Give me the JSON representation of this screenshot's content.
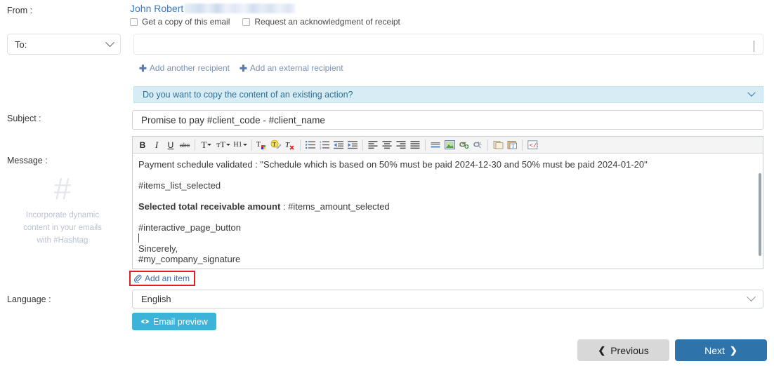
{
  "labels": {
    "from": "From :",
    "subject": "Subject :",
    "message": "Message :",
    "language": "Language :"
  },
  "from": {
    "sender_name": "John Robert",
    "sender_email_redacted": "",
    "copy_checkbox_label": "Get a copy of this email",
    "copy_checked": false,
    "receipt_checkbox_label": "Request an acknowledgment of receipt",
    "receipt_checked": false
  },
  "recipients": {
    "type_select_value": "To:",
    "recipient_value": "",
    "add_another_label": "Add another recipient",
    "add_external_label": "Add an external recipient"
  },
  "copy_action_banner": {
    "text": "Do you want to copy the content of an existing action?"
  },
  "subject": {
    "value": "Promise to pay #client_code - #client_name"
  },
  "message_hint": {
    "glyph": "#",
    "line1": "Incorporate dynamic",
    "line2": "content in your emails",
    "line3": "with #Hashtag"
  },
  "editor": {
    "toolbar": [
      {
        "name": "bold-icon",
        "glyph": "B",
        "style": "bold"
      },
      {
        "name": "italic-icon",
        "glyph": "I",
        "style": "italic"
      },
      {
        "name": "underline-icon",
        "glyph": "U",
        "style": "underline"
      },
      {
        "name": "strikethrough-icon",
        "glyph": "abc",
        "style": "strike"
      },
      {
        "name": "font-family-icon",
        "glyph": "T",
        "style": "dropdown"
      },
      {
        "name": "font-size-icon",
        "glyph": "tT",
        "style": "dropdown"
      },
      {
        "name": "heading-icon",
        "glyph": "H1",
        "style": "dropdown"
      },
      {
        "name": "text-color-icon",
        "glyph": "T",
        "style": "color"
      },
      {
        "name": "background-color-icon",
        "glyph": "T",
        "style": "highlight"
      },
      {
        "name": "remove-format-icon",
        "glyph": "T",
        "style": "removefmt"
      },
      {
        "name": "bulleted-list-icon",
        "glyph": "",
        "style": "ullist"
      },
      {
        "name": "numbered-list-icon",
        "glyph": "",
        "style": "ollist"
      },
      {
        "name": "decrease-indent-icon",
        "glyph": "",
        "style": "outdent"
      },
      {
        "name": "increase-indent-icon",
        "glyph": "",
        "style": "indent"
      },
      {
        "name": "align-left-icon",
        "glyph": "",
        "style": "alignleft"
      },
      {
        "name": "align-center-icon",
        "glyph": "",
        "style": "aligncenter"
      },
      {
        "name": "align-right-icon",
        "glyph": "",
        "style": "alignright"
      },
      {
        "name": "align-justify-icon",
        "glyph": "",
        "style": "alignjustify"
      },
      {
        "name": "horizontal-rule-icon",
        "glyph": "",
        "style": "hr"
      },
      {
        "name": "insert-image-icon",
        "glyph": "",
        "style": "image"
      },
      {
        "name": "insert-link-icon",
        "glyph": "",
        "style": "link"
      },
      {
        "name": "unlink-icon",
        "glyph": "",
        "style": "unlink"
      },
      {
        "name": "paste-icon",
        "glyph": "",
        "style": "paste"
      },
      {
        "name": "paste-as-text-icon",
        "glyph": "",
        "style": "pastetext"
      },
      {
        "name": "source-code-icon",
        "glyph": "",
        "style": "source"
      }
    ],
    "body": [
      {
        "text": "Payment schedule validated : \"Schedule which is based on 50% must be paid 2024-12-30 and 50% must be paid 2024-01-20\"",
        "bold": false,
        "gap": true
      },
      {
        "text": "#items_list_selected",
        "bold": false,
        "gap": true
      },
      {
        "text_bold": "Selected total receivable amount",
        "text_rest": " : #items_amount_selected",
        "bold": "partial",
        "gap": true
      },
      {
        "text": "#interactive_page_button",
        "bold": false,
        "gap": false
      },
      {
        "text": "",
        "caret": true,
        "bold": false,
        "gap": false
      },
      {
        "text": "Sincerely,",
        "bold": false,
        "gap": false
      },
      {
        "text": "#my_company_signature",
        "bold": false,
        "gap": false
      }
    ]
  },
  "attachment": {
    "add_item_label": "Add an item",
    "highlighted": true
  },
  "language": {
    "value": "English"
  },
  "actions": {
    "preview_label": "Email preview",
    "previous_label": "Previous",
    "next_label": "Next"
  },
  "colors": {
    "link_blue": "#3a7ac0",
    "banner_bg": "#d8ecf5",
    "banner_text": "#2f6f93",
    "preview_btn": "#3cb4d9",
    "next_btn": "#2e74ab",
    "prev_btn": "#d8d8d8",
    "highlight_red": "#e02020",
    "hint_grey": "#b9c3d2"
  }
}
